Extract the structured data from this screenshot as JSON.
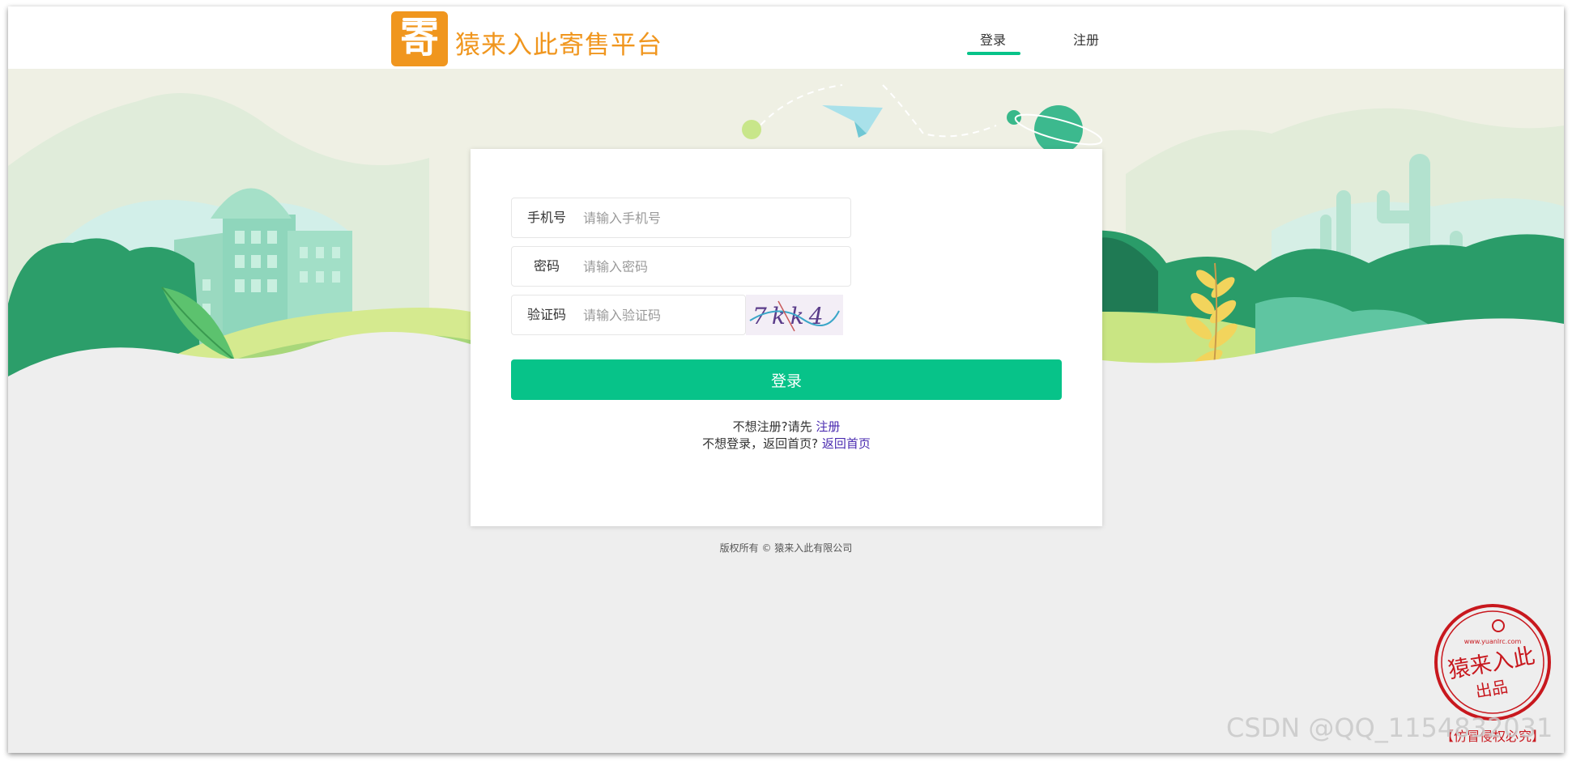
{
  "header": {
    "logo_char": "寄",
    "site_title": "猿来入此寄售平台",
    "nav": [
      {
        "label": "登录",
        "active": true
      },
      {
        "label": "注册",
        "active": false
      }
    ]
  },
  "login_form": {
    "fields": [
      {
        "label": "手机号",
        "placeholder": "请输入手机号",
        "value": ""
      },
      {
        "label": "密码",
        "placeholder": "请输入密码",
        "value": ""
      },
      {
        "label": "验证码",
        "placeholder": "请输入验证码",
        "value": ""
      }
    ],
    "captcha_text": "7kk4",
    "submit_label": "登录",
    "hint_register_prefix": "不想注册?请先",
    "hint_register_link": "注册",
    "hint_home_prefix": "不想登录，返回首页?",
    "hint_home_link": "返回首页"
  },
  "footer": {
    "copyright": "版权所有 © 猿来入此有限公司"
  },
  "seal": {
    "main_text": "猿来入此",
    "sub_text": "出品",
    "url_text": "www.yuanlrc.com",
    "bottom_text": "【仿冒侵权必究】"
  },
  "watermark": "CSDN @QQ_1154832031",
  "colors": {
    "accent": "#07c389",
    "brand": "#f0961e",
    "link": "#4a2bb0",
    "seal": "#c8181e"
  }
}
